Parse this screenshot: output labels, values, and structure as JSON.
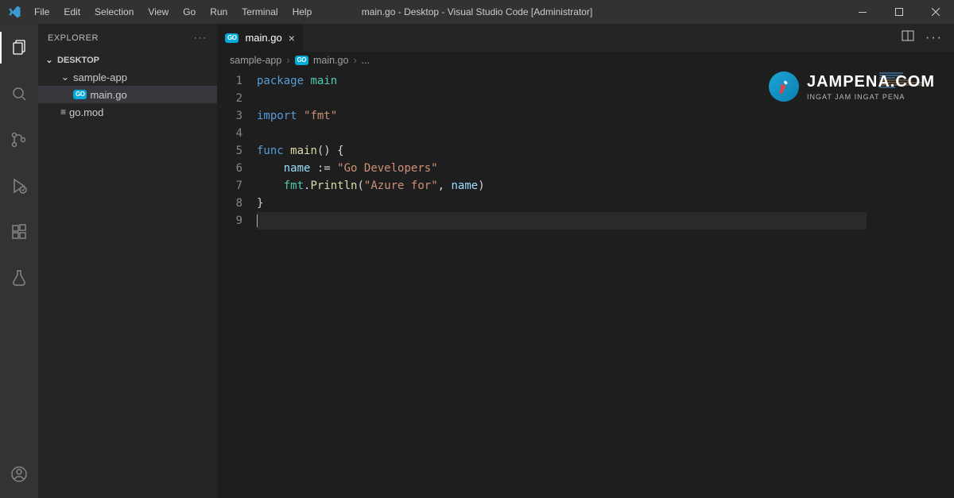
{
  "titlebar": {
    "menus": [
      "File",
      "Edit",
      "Selection",
      "View",
      "Go",
      "Run",
      "Terminal",
      "Help"
    ],
    "title": "main.go - Desktop - Visual Studio Code [Administrator]"
  },
  "sidebar": {
    "header": "EXPLORER",
    "section": "DESKTOP",
    "items": [
      {
        "label": "sample-app",
        "kind": "folder",
        "indent": 1,
        "open": true
      },
      {
        "label": "main.go",
        "kind": "go",
        "indent": 2,
        "selected": true
      },
      {
        "label": "go.mod",
        "kind": "file",
        "indent": 1
      }
    ]
  },
  "tab": {
    "label": "main.go"
  },
  "breadcrumb": {
    "folder": "sample-app",
    "file": "main.go",
    "more": "..."
  },
  "code_lines": [
    [
      [
        "kw",
        "package"
      ],
      [
        "txt",
        " "
      ],
      [
        "pkg",
        "main"
      ]
    ],
    [],
    [
      [
        "kw",
        "import"
      ],
      [
        "txt",
        " "
      ],
      [
        "str",
        "\"fmt\""
      ]
    ],
    [],
    [
      [
        "kw",
        "func"
      ],
      [
        "txt",
        " "
      ],
      [
        "fn",
        "main"
      ],
      [
        "op",
        "() {"
      ]
    ],
    [
      [
        "txt",
        "    "
      ],
      [
        "nm",
        "name"
      ],
      [
        "txt",
        " "
      ],
      [
        "op",
        ":="
      ],
      [
        "txt",
        " "
      ],
      [
        "str",
        "\"Go Developers\""
      ]
    ],
    [
      [
        "txt",
        "    "
      ],
      [
        "pkg",
        "fmt"
      ],
      [
        "op",
        "."
      ],
      [
        "fn",
        "Println"
      ],
      [
        "op",
        "("
      ],
      [
        "str",
        "\"Azure for\""
      ],
      [
        "op",
        ", "
      ],
      [
        "nm",
        "name"
      ],
      [
        "op",
        ")"
      ]
    ],
    [
      [
        "op",
        "}"
      ]
    ],
    []
  ],
  "watermark": {
    "title": "JAMPENA.COM",
    "subtitle": "INGAT JAM INGAT PENA"
  }
}
